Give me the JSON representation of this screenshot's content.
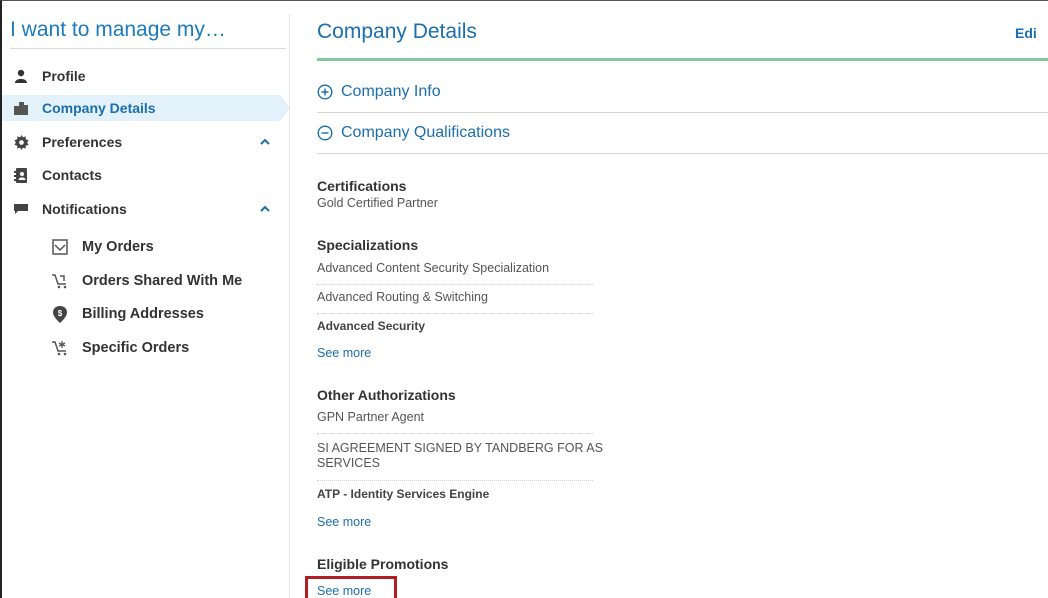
{
  "sidebar": {
    "title": "I want to manage my…",
    "items": [
      {
        "label": "Profile",
        "icon": "person-icon"
      },
      {
        "label": "Company Details",
        "icon": "building-icon",
        "active": true
      },
      {
        "label": "Preferences",
        "icon": "gear-icon",
        "expanded": true
      },
      {
        "label": "Contacts",
        "icon": "address-book-icon"
      },
      {
        "label": "Notifications",
        "icon": "speech-bubble-icon",
        "expanded": true
      }
    ],
    "sub_items": [
      {
        "label": "My Orders",
        "icon": "inbox-icon"
      },
      {
        "label": "Orders Shared With Me",
        "icon": "shared-cart-icon"
      },
      {
        "label": "Billing Addresses",
        "icon": "billing-pin-icon"
      },
      {
        "label": "Specific Orders",
        "icon": "cart-star-icon"
      }
    ]
  },
  "main": {
    "title": "Company Details",
    "edit_label": "Edi",
    "sections": [
      {
        "label": "Company Info",
        "state": "collapsed"
      },
      {
        "label": "Company Qualifications",
        "state": "expanded"
      }
    ],
    "certifications": {
      "title": "Certifications",
      "value": "Gold Certified Partner"
    },
    "specializations": {
      "title": "Specializations",
      "items": [
        "Advanced Content Security Specialization",
        "Advanced Routing & Switching",
        "Advanced Security"
      ],
      "see_more": "See more"
    },
    "other_authorizations": {
      "title": "Other Authorizations",
      "items": [
        "GPN Partner Agent",
        "SI AGREEMENT SIGNED BY TANDBERG FOR AS SERVICES",
        "ATP - Identity Services Engine"
      ],
      "see_more": "See more"
    },
    "eligible_promotions": {
      "title": "Eligible Promotions",
      "see_more": "See more"
    }
  },
  "colors": {
    "accent": "#1b6fae",
    "active_bg": "#e3f1fb",
    "title_rule": "#7fc99a",
    "highlight": "#b01d24"
  }
}
